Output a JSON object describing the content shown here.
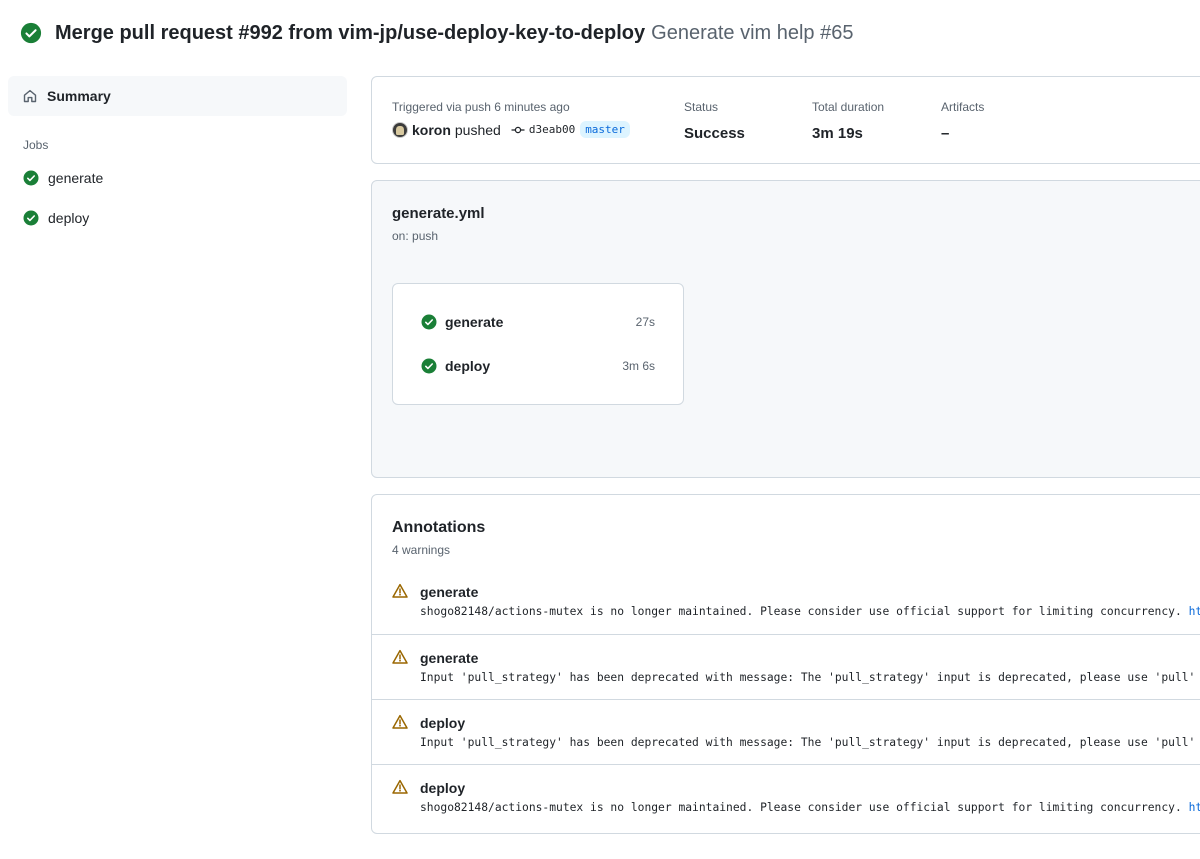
{
  "run": {
    "title": "Merge pull request #992 from vim-jp/use-deploy-key-to-deploy",
    "workflow_run": "Generate vim help #65",
    "status_icon": "check-circle-fill-icon",
    "success_color": "#1a7f37"
  },
  "sidebar": {
    "summary_label": "Summary",
    "jobs_heading": "Jobs",
    "jobs": [
      {
        "label": "generate",
        "icon": "check-circle-fill-icon"
      },
      {
        "label": "deploy",
        "icon": "check-circle-fill-icon"
      }
    ]
  },
  "summary": {
    "trigger_text": "Triggered via push 6 minutes ago",
    "actor": "koron",
    "action": "pushed",
    "commit_sha": "d3eab00",
    "branch": "master",
    "status_label": "Status",
    "status_value": "Success",
    "duration_label": "Total duration",
    "duration_value": "3m 19s",
    "artifacts_label": "Artifacts",
    "artifacts_value": "–"
  },
  "workflow": {
    "file": "generate.yml",
    "trigger": "on: push",
    "jobs": [
      {
        "name": "generate",
        "duration": "27s"
      },
      {
        "name": "deploy",
        "duration": "3m 6s"
      }
    ]
  },
  "annotations": {
    "title": "Annotations",
    "count_text": "4 warnings",
    "warning_color": "#9a6700",
    "items": [
      {
        "job": "generate",
        "message": "shogo82148/actions-mutex is no longer maintained. Please consider use official support for limiting concurrency.",
        "link": "https"
      },
      {
        "job": "generate",
        "message": "Input 'pull_strategy' has been deprecated with message: The 'pull_strategy' input is deprecated, please use 'pull'",
        "link": ""
      },
      {
        "job": "deploy",
        "message": "Input 'pull_strategy' has been deprecated with message: The 'pull_strategy' input is deprecated, please use 'pull'",
        "link": ""
      },
      {
        "job": "deploy",
        "message": "shogo82148/actions-mutex is no longer maintained. Please consider use official support for limiting concurrency.",
        "link": "https"
      }
    ]
  }
}
